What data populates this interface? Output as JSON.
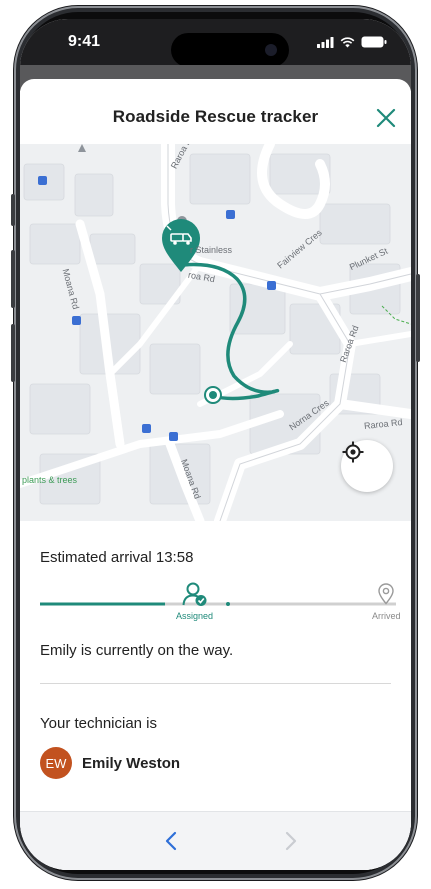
{
  "status_bar": {
    "time": "9:41"
  },
  "header": {
    "title": "Roadside Rescue tracker"
  },
  "map": {
    "labels": {
      "raroa_rd_top": "Raroa Rd",
      "stainless": "r Stainless",
      "road_short": "roa Rd",
      "fairview": "Fairview Cres",
      "plunket": "Plunket St",
      "raroa_rd_right": "Raroa Rd",
      "moana_rd_left": "Moana Rd",
      "norna_cres": "Norna Cres",
      "raroa_rd_bottom": "Raroa Rd",
      "moana_rd_bottom": "Moana Rd",
      "plants": "plants & trees"
    }
  },
  "eta": {
    "label": "Estimated arrival 13:58"
  },
  "progress": {
    "assigned_label": "Assigned",
    "arrived_label": "Arrived",
    "completed_fraction": 0.4
  },
  "status_message": "Emily is currently on the way.",
  "technician": {
    "heading": "Your technician is",
    "initials": "EW",
    "name": "Emily Weston"
  },
  "colors": {
    "accent": "#1f8a7a",
    "avatar": "#c2521f"
  },
  "icons": [
    "close-icon",
    "locate-icon",
    "tow-truck-icon",
    "technician-icon",
    "pin-icon",
    "chevron-left-icon",
    "chevron-right-icon"
  ]
}
